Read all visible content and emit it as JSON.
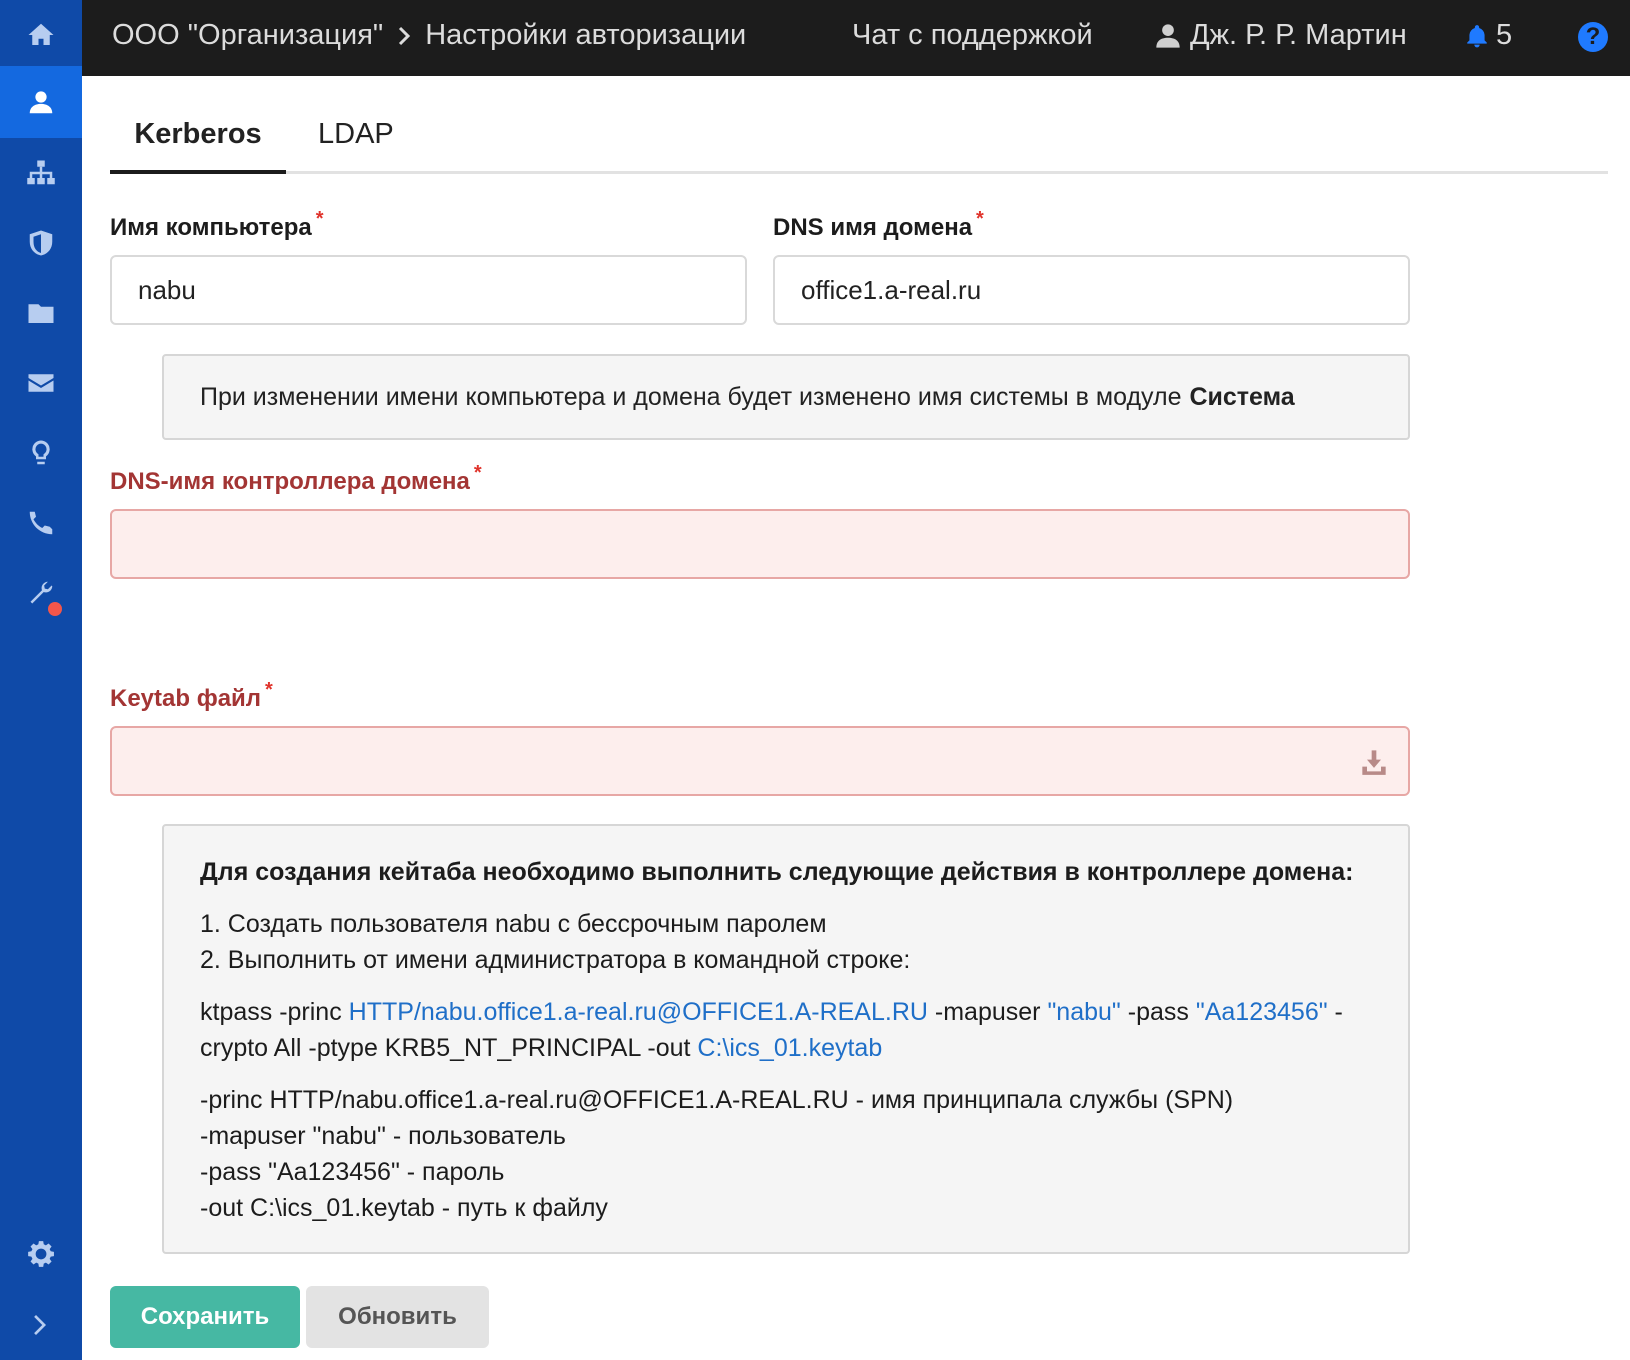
{
  "sidebar": {
    "items": [
      {
        "icon": "home-icon"
      },
      {
        "icon": "user-icon",
        "active": true
      },
      {
        "icon": "hierarchy-icon"
      },
      {
        "icon": "shield-icon"
      },
      {
        "icon": "folder-icon"
      },
      {
        "icon": "envelope-icon"
      },
      {
        "icon": "lightbulb-icon"
      },
      {
        "icon": "phone-icon"
      },
      {
        "icon": "wrench-icon",
        "badge": true
      },
      {
        "icon": "gear-icon"
      },
      {
        "icon": "chevron-right-icon"
      }
    ],
    "badge_color": "#f3564a",
    "background": "#0f4aa8",
    "active_background": "#1469e0"
  },
  "topbar": {
    "organization": "ООО \"Организация\"",
    "page": "Настройки авторизации",
    "support": "Чат с поддержкой",
    "user": "Дж. Р. Р. Мартин",
    "notifications": "5",
    "help": "?"
  },
  "tabs": [
    {
      "label": "Kerberos",
      "active": true
    },
    {
      "label": "LDAP",
      "active": false
    }
  ],
  "form": {
    "computer_name": {
      "label": "Имя компьютера",
      "value": "nabu"
    },
    "dns_domain": {
      "label": "DNS имя домена",
      "value": "office1.a-real.ru"
    },
    "note_text": "При изменении имени компьютера и домена будет изменено имя системы в модуле",
    "note_bold": "Система",
    "dc_dns": {
      "label": "DNS-имя контроллера домена",
      "value": ""
    },
    "keytab": {
      "label": "Keytab файл",
      "value": ""
    },
    "required_mark": "*"
  },
  "info": {
    "title": "Для создания кейтаба необходимо выполнить следующие действия в контроллере домена:",
    "step1": "1. Создать пользователя nabu с бессрочным паролем",
    "step2": "2. Выполнить от имени администратора в командной строке:",
    "cmd": {
      "p1": "ktpass -princ ",
      "principal": "HTTP/nabu.office1.a-real.ru@OFFICE1.A-REAL.RU",
      "p2": " -mapuser ",
      "mapuser": "\"nabu\"",
      "p3": " -pass ",
      "pass": "\"Aa123456\"",
      "p4": " -",
      "p5": "crypto All -ptype KRB5_NT_PRINCIPAL -out ",
      "out": "C:\\ics_01.keytab"
    },
    "legend": [
      "-princ HTTP/nabu.office1.a-real.ru@OFFICE1.A-REAL.RU - имя принципала службы (SPN)",
      "-mapuser \"nabu\" - пользователь",
      "-pass \"Aa123456\" - пароль",
      "-out C:\\ics_01.keytab - путь к файлу"
    ]
  },
  "buttons": {
    "save": "Сохранить",
    "refresh": "Обновить"
  },
  "colors": {
    "accent": "#1f7aff",
    "error": "#a33534",
    "save": "#46b8a3",
    "link": "#1f6fc8"
  }
}
